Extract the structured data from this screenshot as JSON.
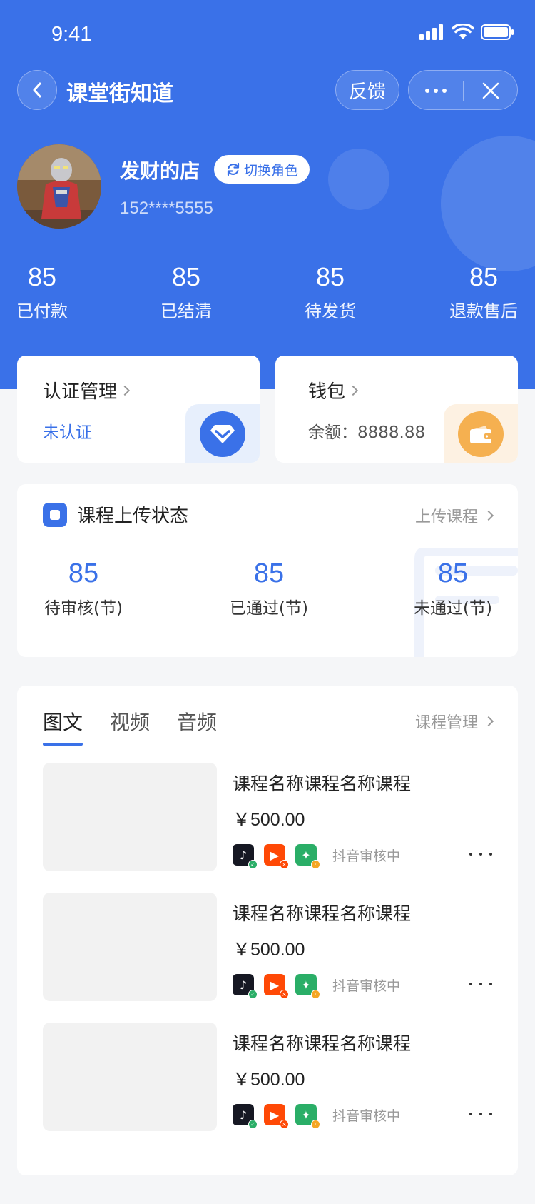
{
  "status_bar": {
    "time": "9:41"
  },
  "nav": {
    "title": "课堂街知道",
    "feedback_label": "反馈"
  },
  "profile": {
    "shop_name": "发财的店",
    "switch_role_label": "切换角色",
    "phone": "152****5555"
  },
  "stats": [
    {
      "num": "85",
      "label": "已付款"
    },
    {
      "num": "85",
      "label": "已结清"
    },
    {
      "num": "85",
      "label": "待发货"
    },
    {
      "num": "85",
      "label": "退款售后"
    }
  ],
  "cert": {
    "title": "认证管理",
    "status": "未认证",
    "icon": "diamond-icon"
  },
  "wallet": {
    "title": "钱包",
    "balance": "余额：8888.88",
    "icon": "wallet-icon"
  },
  "upload": {
    "title": "课程上传状态",
    "link": "上传课程",
    "stats": [
      {
        "num": "85",
        "label": "待审核(节)"
      },
      {
        "num": "85",
        "label": "已通过(节)"
      },
      {
        "num": "85",
        "label": "未通过(节)"
      }
    ]
  },
  "courses": {
    "tabs": [
      "图文",
      "视频",
      "音频"
    ],
    "manage_link": "课程管理",
    "items": [
      {
        "name": "课程名称课程名称课程",
        "price": "￥500.00",
        "review_status": "抖音审核中"
      },
      {
        "name": "课程名称课程名称课程",
        "price": "￥500.00",
        "review_status": "抖音审核中"
      },
      {
        "name": "课程名称课程名称课程",
        "price": "￥500.00",
        "review_status": "抖音审核中"
      }
    ]
  },
  "colors": {
    "primary": "#3a71e8",
    "douyin": "#161823",
    "kuaishou": "#ff4906",
    "wechat": "#2aae67",
    "warning": "#f5a623"
  }
}
